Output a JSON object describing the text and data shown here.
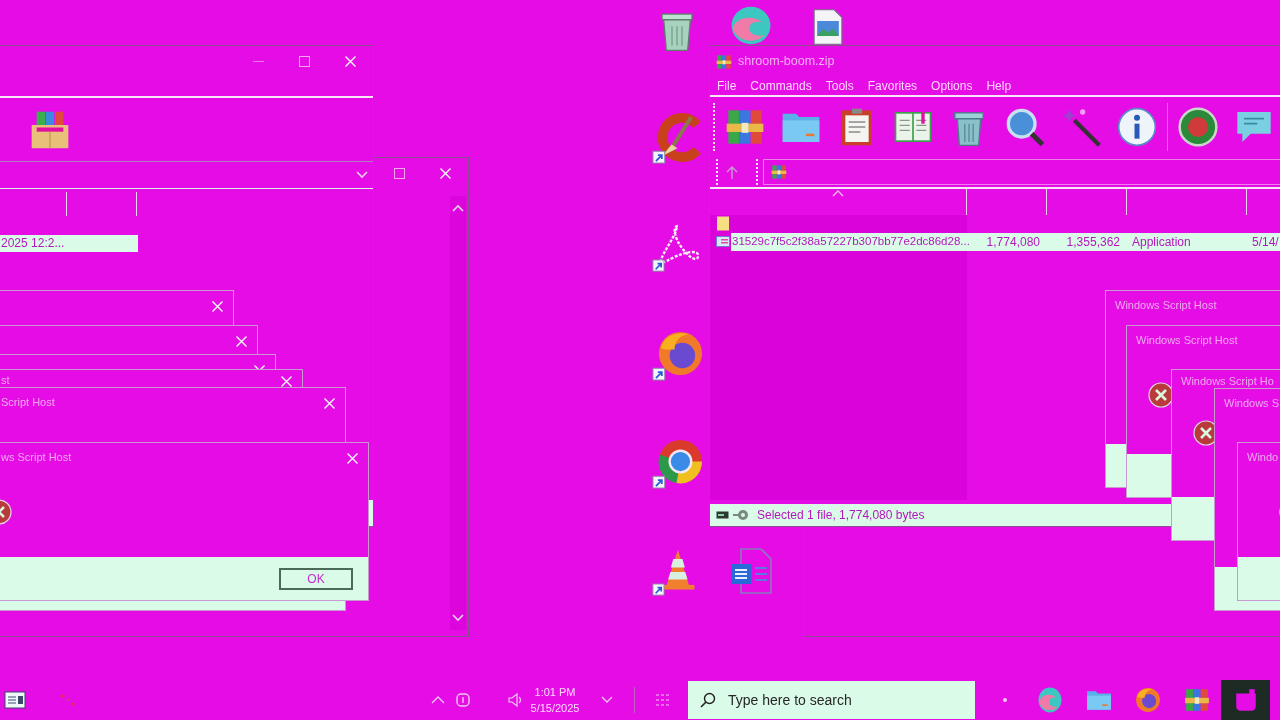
{
  "explorer": {
    "rows": [
      {
        "modified": "2025 12:2...",
        "selected": true
      }
    ]
  },
  "winrar": {
    "title": "shroom-boom.zip",
    "menu": [
      "File",
      "Commands",
      "Tools",
      "Favorites",
      "Options",
      "Help"
    ],
    "rows": [
      {
        "kind": "folder",
        "selected": false
      },
      {
        "kind": "file",
        "name": "31529c7f5c2f38a57227b307bb77e2dc86d28...",
        "size": "1,774,080",
        "packed": "1,355,362",
        "type": "Application",
        "modified": "5/14/",
        "selected": true
      }
    ],
    "status": "Selected 1 file, 1,774,080 bytes"
  },
  "left_dialogs": [
    {
      "title": "st"
    },
    {
      "title": "Script Host"
    },
    {
      "title": "ws Script Host",
      "button": "OK"
    }
  ],
  "right_dialogs": [
    {
      "title": "Windows Script Host"
    },
    {
      "title": "Windows Script Host"
    },
    {
      "title": "Windows Script Ho"
    },
    {
      "title": "Windows S"
    },
    {
      "title": "Windo"
    }
  ],
  "taskbar": {
    "clock": {
      "time": "1:01 PM",
      "date": "5/15/2025"
    },
    "search": {
      "placeholder": "Type here to search"
    },
    "apps": [
      {
        "kind": "swirl",
        "selected": false
      },
      {
        "kind": "folder",
        "selected": false
      },
      {
        "kind": "globe",
        "selected": false
      },
      {
        "kind": "books",
        "selected": false
      },
      {
        "kind": "window",
        "selected": true
      }
    ]
  }
}
